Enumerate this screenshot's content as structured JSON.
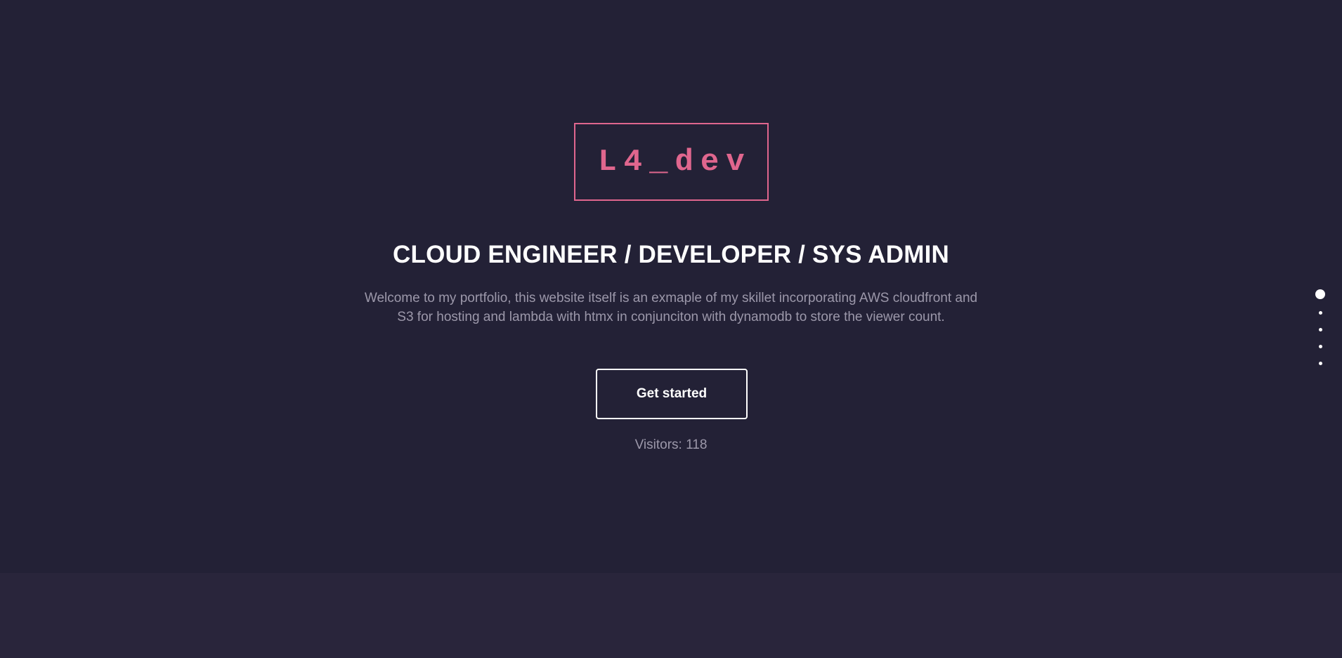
{
  "hero": {
    "logo_text": "L4_dev",
    "headline": "CLOUD ENGINEER / DEVELOPER / SYS ADMIN",
    "description": "Welcome to my portfolio, this website itself is an exmaple of my skillet incorporating AWS cloudfront and S3 for hosting and lambda with htmx in conjunciton with dynamodb to store the viewer count.",
    "cta_label": "Get started",
    "visitors_label": "Visitors: 118"
  },
  "section_nav": {
    "count": 5,
    "active_index": 0
  },
  "colors": {
    "background": "#232136",
    "accent": "#e0668e",
    "text": "#ffffff",
    "muted_text": "#9c98aa"
  }
}
